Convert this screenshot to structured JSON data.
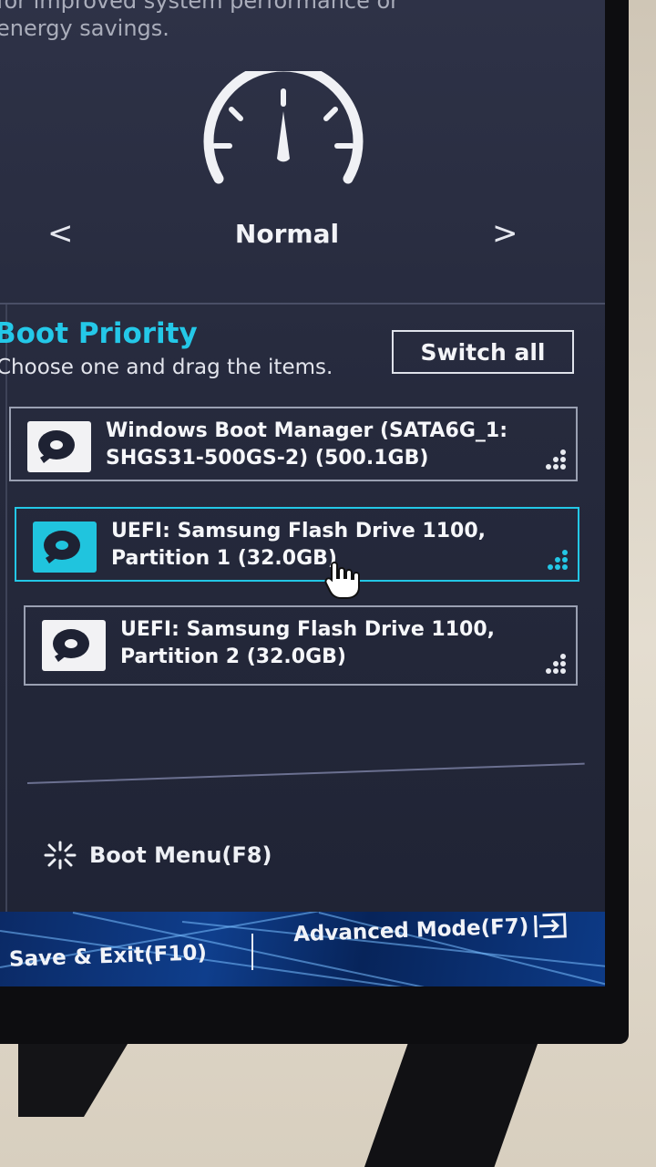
{
  "header": {
    "description_fragment": "for improved system performance or\nenergy savings."
  },
  "performance": {
    "mode_label": "Normal",
    "prev_arrow": "<",
    "next_arrow": ">",
    "gauge_icon": "speedometer-icon"
  },
  "boot_priority": {
    "title": "Boot Priority",
    "subtitle": "Choose one and drag the items.",
    "switch_all_label": "Switch all",
    "items": [
      {
        "label": "Windows Boot Manager (SATA6G_1: SHGS31-500GS-2) (500.1GB)",
        "icon": "hard-drive-icon",
        "selected": false
      },
      {
        "label": "UEFI: Samsung Flash Drive 1100, Partition 1 (32.0GB)",
        "icon": "hard-drive-icon",
        "selected": true
      },
      {
        "label": "UEFI: Samsung Flash Drive 1100, Partition 2 (32.0GB)",
        "icon": "hard-drive-icon",
        "selected": false
      }
    ]
  },
  "boot_menu": {
    "label": "Boot Menu(F8)",
    "icon": "sparkle-icon"
  },
  "footer": {
    "save_exit_label": "Save & Exit(F10)",
    "advanced_mode_label": "Advanced Mode(F7)",
    "advanced_icon": "exit-arrow-icon"
  },
  "colors": {
    "accent": "#23c7e6",
    "screen_bg": "#262a3d",
    "footer_bg": "#0f3e8c"
  }
}
